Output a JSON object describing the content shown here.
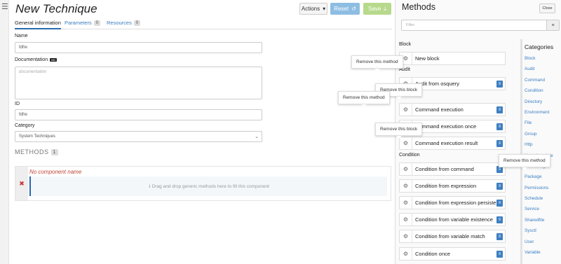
{
  "editor": {
    "title": "New Technique",
    "actions_label": "Actions",
    "reset_label": "Reset",
    "save_label": "Save",
    "tabs": [
      {
        "label": "General information"
      },
      {
        "label": "Parameters",
        "count": "0"
      },
      {
        "label": "Resources",
        "count": "0"
      }
    ],
    "name_label": "Name",
    "name_value": "fdfre",
    "doc_label": "Documentation",
    "doc_badge": "MD",
    "doc_placeholder": "documentation",
    "id_label": "ID",
    "id_value": "fdfre",
    "category_label": "Category",
    "category_value": "System Techniques",
    "methods_title": "METHODS",
    "methods_count": "1",
    "component_name": "No component name",
    "drop_text": "Drag and drop generic methods here to fill this component"
  },
  "methods_panel": {
    "title": "Methods",
    "close_label": "Close",
    "filter_placeholder": "Filter",
    "groups": [
      {
        "name": "Block",
        "items": [
          "New block"
        ]
      },
      {
        "name": "Audit",
        "items": [
          "Audit from osquery"
        ]
      },
      {
        "name": "Command",
        "items": [
          "Command execution",
          "Command execution once",
          "Command execution result"
        ]
      },
      {
        "name": "Condition",
        "items": [
          "Condition from command",
          "Condition from expression",
          "Condition from expression persistent",
          "Condition from variable existence",
          "Condition from variable match",
          "Condition once"
        ]
      }
    ],
    "categories_title": "Categories",
    "categories": [
      "Block",
      "Audit",
      "Command",
      "Condition",
      "Directory",
      "Environment",
      "File",
      "Group",
      "Http",
      "Kernel module",
      "Monitoring",
      "Package",
      "Permissions",
      "Schedule",
      "Service",
      "Sharedfile",
      "Sysctl",
      "User",
      "Variable"
    ]
  },
  "tooltips": {
    "remove_method": "Remove this method",
    "remove_block": "Remove this block"
  }
}
